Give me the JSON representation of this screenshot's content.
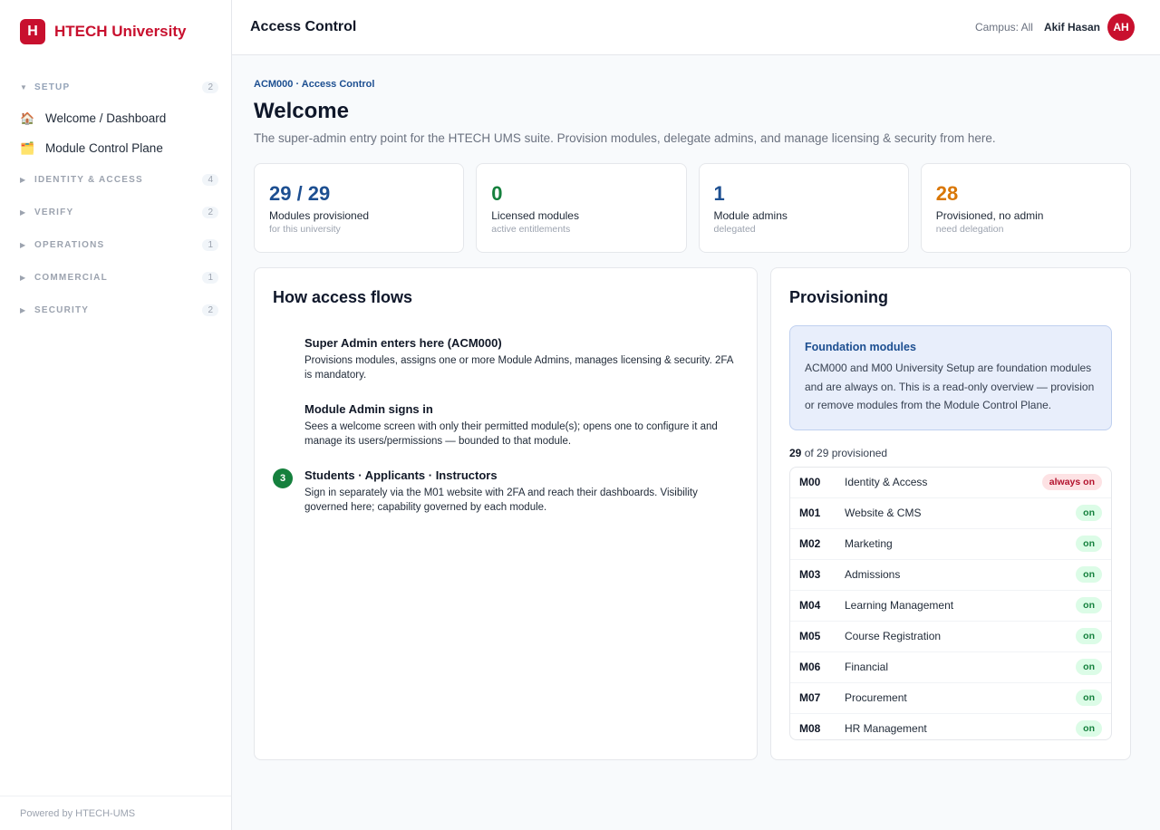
{
  "brand": {
    "logo_letter": "H",
    "name": "HTECH University",
    "color": "#c8102e"
  },
  "sidebar": {
    "sections": [
      {
        "label": "SETUP",
        "count": "2",
        "open": true,
        "items": [
          {
            "icon": "🏠",
            "icon_name": "house-icon",
            "label": "Welcome / Dashboard"
          },
          {
            "icon": "🗂️",
            "icon_name": "folder-icon",
            "label": "Module Control Plane"
          }
        ]
      },
      {
        "label": "IDENTITY & ACCESS",
        "count": "4",
        "open": false
      },
      {
        "label": "VERIFY",
        "count": "2",
        "open": false
      },
      {
        "label": "OPERATIONS",
        "count": "1",
        "open": false
      },
      {
        "label": "COMMERCIAL",
        "count": "1",
        "open": false
      },
      {
        "label": "SECURITY",
        "count": "2",
        "open": false
      }
    ],
    "footer": "Powered by HTECH-UMS"
  },
  "topbar": {
    "title": "Access Control",
    "campus": "Campus: All",
    "user": "Akif Hasan",
    "avatar_initials": "AH"
  },
  "main": {
    "breadcrumb": "ACM000 · Access Control",
    "title": "Welcome",
    "subtitle": "The super-admin entry point for the HTECH UMS suite. Provision modules, delegate admins, and manage licensing & security from here.",
    "stats": [
      {
        "value": "29 / 29",
        "label": "Modules provisioned",
        "sub": "for this university",
        "color": "#1d4f91"
      },
      {
        "value": "0",
        "label": "Licensed modules",
        "sub": "active entitlements",
        "color": "#15803d"
      },
      {
        "value": "1",
        "label": "Module admins",
        "sub": "delegated",
        "color": "#1d4f91"
      },
      {
        "value": "28",
        "label": "Provisioned, no admin",
        "sub": "need delegation",
        "color": "#d97706"
      }
    ],
    "flow": {
      "title": "How access flows",
      "steps": [
        {
          "badge": "",
          "title": "Super Admin enters here (ACM000)",
          "desc": "Provisions modules, assigns one or more Module Admins, manages licensing & security. 2FA is mandatory."
        },
        {
          "badge": "",
          "title": "Module Admin signs in",
          "desc": "Sees a welcome screen with only their permitted module(s); opens one to configure it and manage its users/permissions — bounded to that module."
        },
        {
          "badge": "3",
          "title": "Students · Applicants · Instructors",
          "desc": "Sign in separately via the M01 website with 2FA and reach their dashboards. Visibility governed here; capability governed by each module."
        }
      ]
    },
    "provisioning": {
      "title": "Provisioning",
      "info_title": "Foundation modules",
      "info_text": "ACM000 and M00 University Setup are foundation modules and are always on. This is a read-only overview — provision or remove modules from the Module Control Plane.",
      "count_bold": "29",
      "count_rest": " of 29 provisioned",
      "modules": [
        {
          "code": "M00",
          "name": "Identity & Access",
          "status": "always on",
          "kind": "always"
        },
        {
          "code": "M01",
          "name": "Website & CMS",
          "status": "on",
          "kind": "on"
        },
        {
          "code": "M02",
          "name": "Marketing",
          "status": "on",
          "kind": "on"
        },
        {
          "code": "M03",
          "name": "Admissions",
          "status": "on",
          "kind": "on"
        },
        {
          "code": "M04",
          "name": "Learning Management",
          "status": "on",
          "kind": "on"
        },
        {
          "code": "M05",
          "name": "Course Registration",
          "status": "on",
          "kind": "on"
        },
        {
          "code": "M06",
          "name": "Financial",
          "status": "on",
          "kind": "on"
        },
        {
          "code": "M07",
          "name": "Procurement",
          "status": "on",
          "kind": "on"
        },
        {
          "code": "M08",
          "name": "HR Management",
          "status": "on",
          "kind": "on"
        }
      ]
    }
  }
}
